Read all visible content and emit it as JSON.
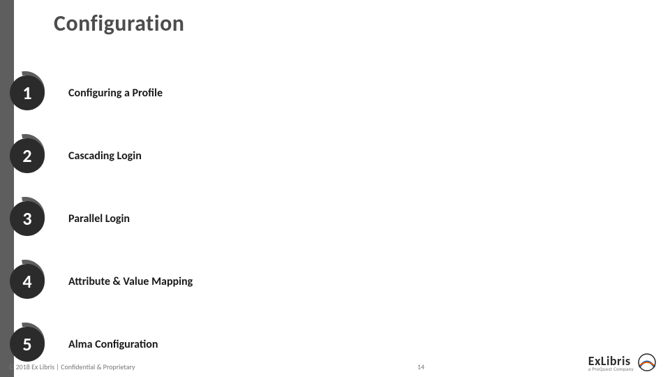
{
  "title": "Configuration",
  "items": [
    {
      "num": "1",
      "label": "Configuring a Profile"
    },
    {
      "num": "2",
      "label": "Cascading Login"
    },
    {
      "num": "3",
      "label": "Parallel Login"
    },
    {
      "num": "4",
      "label": "Attribute & Value Mapping"
    },
    {
      "num": "5",
      "label": "Alma Configuration"
    }
  ],
  "footer": "© 2018 Ex Libris | Confidential & Proprietary",
  "page_number": "14",
  "logo": {
    "name": "ExLibris",
    "subtitle": "a ProQuest Company"
  }
}
